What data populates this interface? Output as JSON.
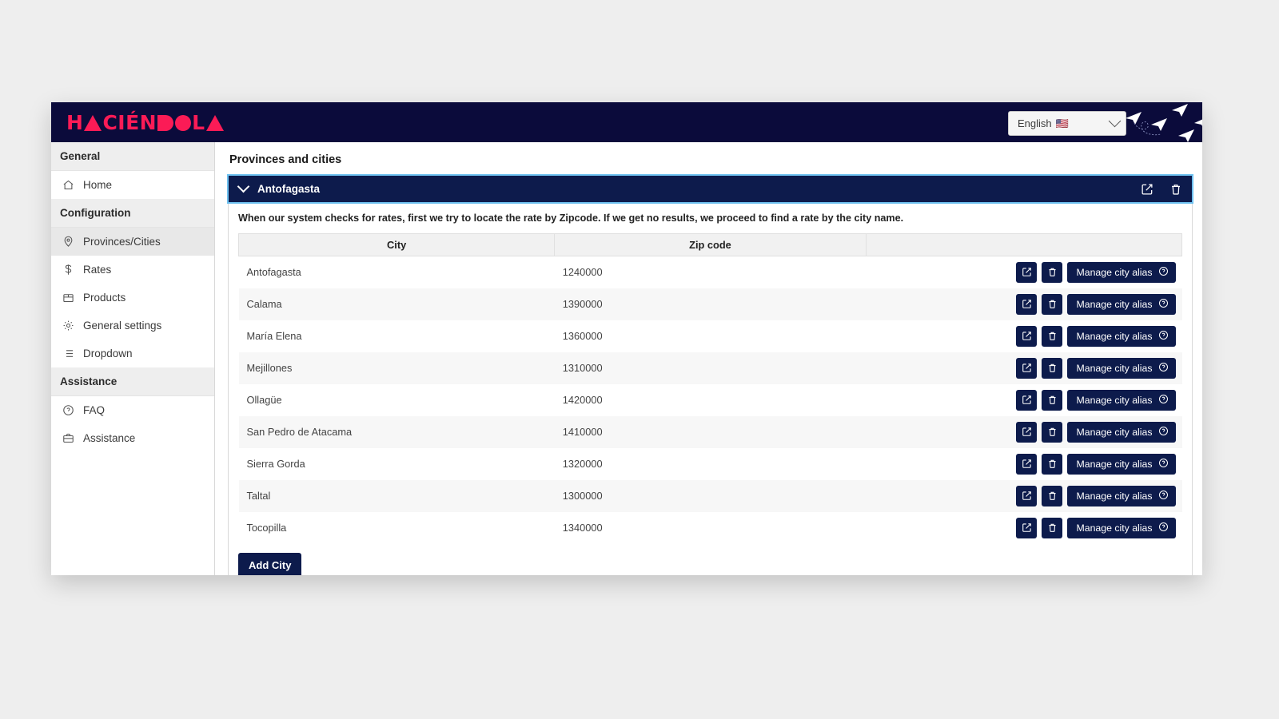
{
  "brand": {
    "logo_text": "HACIÉNDOLA",
    "logo_part_1": "H",
    "logo_part_2": "CIÉN",
    "logo_part_3": "OL",
    "accent_color": "#fb1b56",
    "navy_color": "#0b0b3b"
  },
  "topbar": {
    "language_label": "English",
    "language_flag": "🇺🇸",
    "chevron_icon": "chevron-down-icon",
    "planes_icon": "paper-planes-decoration"
  },
  "sidebar": {
    "groups": [
      {
        "label": "General",
        "items": [
          {
            "label": "Home",
            "icon": "home-icon",
            "active": false
          }
        ]
      },
      {
        "label": "Configuration",
        "items": [
          {
            "label": "Provinces/Cities",
            "icon": "map-pin-icon",
            "active": true
          },
          {
            "label": "Rates",
            "icon": "dollar-icon",
            "active": false
          },
          {
            "label": "Products",
            "icon": "box-icon",
            "active": false
          },
          {
            "label": "General settings",
            "icon": "gear-icon",
            "active": false
          },
          {
            "label": "Dropdown",
            "icon": "list-icon",
            "active": false
          }
        ]
      },
      {
        "label": "Assistance",
        "items": [
          {
            "label": "FAQ",
            "icon": "question-circle-icon",
            "active": false
          },
          {
            "label": "Assistance",
            "icon": "briefcase-icon",
            "active": false
          }
        ]
      }
    ]
  },
  "main": {
    "page_title": "Provinces and cities",
    "province": {
      "name": "Antofagasta",
      "expanded": true,
      "edit_icon": "edit-icon",
      "delete_icon": "trash-icon"
    },
    "rate_note": "When our system checks for rates, first we try to locate the rate by Zipcode. If we get no results, we proceed to find a rate by the city name.",
    "table": {
      "columns": [
        "City",
        "Zip code",
        ""
      ],
      "rows": [
        {
          "city": "Antofagasta",
          "zip": "1240000"
        },
        {
          "city": "Calama",
          "zip": "1390000"
        },
        {
          "city": "María Elena",
          "zip": "1360000"
        },
        {
          "city": "Mejillones",
          "zip": "1310000"
        },
        {
          "city": "Ollagüe",
          "zip": "1420000"
        },
        {
          "city": "San Pedro de Atacama",
          "zip": "1410000"
        },
        {
          "city": "Sierra Gorda",
          "zip": "1320000"
        },
        {
          "city": "Taltal",
          "zip": "1300000"
        },
        {
          "city": "Tocopilla",
          "zip": "1340000"
        }
      ],
      "row_actions": {
        "edit_icon": "edit-icon",
        "delete_icon": "trash-icon",
        "alias_label": "Manage city alias",
        "alias_help_icon": "question-circle-icon"
      }
    },
    "add_city_label": "Add City"
  }
}
